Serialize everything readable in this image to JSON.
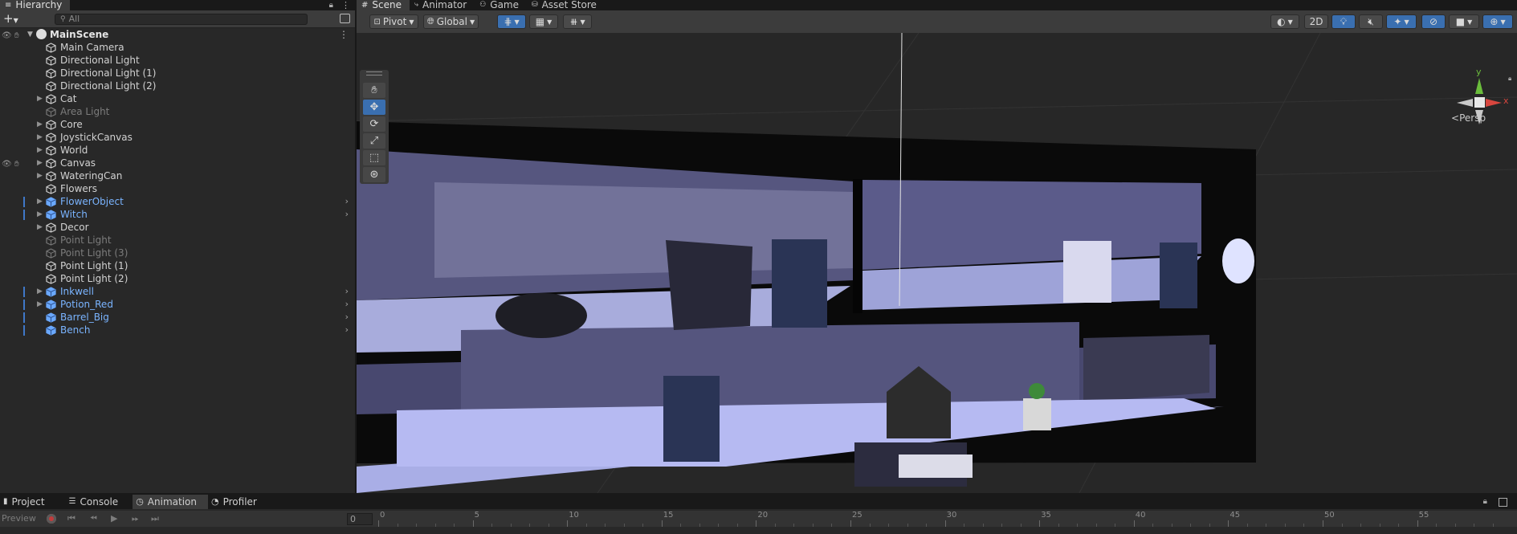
{
  "hierarchy": {
    "tab_label": "Hierarchy",
    "search_placeholder": "All",
    "scene_name": "MainScene",
    "items": [
      {
        "label": "Main Camera",
        "expandable": false,
        "state": "normal"
      },
      {
        "label": "Directional Light",
        "expandable": false,
        "state": "normal"
      },
      {
        "label": "Directional Light (1)",
        "expandable": false,
        "state": "normal"
      },
      {
        "label": "Directional Light (2)",
        "expandable": false,
        "state": "normal"
      },
      {
        "label": "Cat",
        "expandable": true,
        "state": "normal"
      },
      {
        "label": "Area Light",
        "expandable": false,
        "state": "dim"
      },
      {
        "label": "Core",
        "expandable": true,
        "state": "normal"
      },
      {
        "label": "JoystickCanvas",
        "expandable": true,
        "state": "normal"
      },
      {
        "label": "World",
        "expandable": true,
        "state": "normal"
      },
      {
        "label": "Canvas",
        "expandable": true,
        "state": "normal"
      },
      {
        "label": "WateringCan",
        "expandable": true,
        "state": "normal"
      },
      {
        "label": "Flowers",
        "expandable": false,
        "state": "normal"
      },
      {
        "label": "FlowerObject",
        "expandable": true,
        "state": "prefab"
      },
      {
        "label": "Witch",
        "expandable": true,
        "state": "prefab"
      },
      {
        "label": "Decor",
        "expandable": true,
        "state": "normal"
      },
      {
        "label": "Point Light",
        "expandable": false,
        "state": "dim"
      },
      {
        "label": "Point Light (3)",
        "expandable": false,
        "state": "dim"
      },
      {
        "label": "Point Light (1)",
        "expandable": false,
        "state": "normal"
      },
      {
        "label": "Point Light (2)",
        "expandable": false,
        "state": "normal"
      },
      {
        "label": "Inkwell",
        "expandable": true,
        "state": "prefab"
      },
      {
        "label": "Potion_Red",
        "expandable": true,
        "state": "prefab"
      },
      {
        "label": "Barrel_Big",
        "expandable": false,
        "state": "prefab"
      },
      {
        "label": "Bench",
        "expandable": false,
        "state": "prefab"
      }
    ]
  },
  "scene_tabs": [
    "Scene",
    "Animator",
    "Game",
    "Asset Store"
  ],
  "scene_toolbar": {
    "pivot_label": "Pivot",
    "global_label": "Global",
    "mode_2d": "2D",
    "persp_label": "Persp"
  },
  "gizmo": {
    "y": "y",
    "x": "x"
  },
  "bottom_tabs": [
    "Project",
    "Console",
    "Animation",
    "Profiler"
  ],
  "animation": {
    "preview_label": "Preview",
    "frame_value": "0",
    "timeline_labels": [
      "0",
      "5",
      "10",
      "15",
      "20",
      "25",
      "30",
      "35",
      "40",
      "45",
      "50",
      "55"
    ]
  },
  "colors": {
    "accent": "#3a6fb0",
    "prefab_text": "#7ab4ff",
    "panel": "#282828"
  }
}
